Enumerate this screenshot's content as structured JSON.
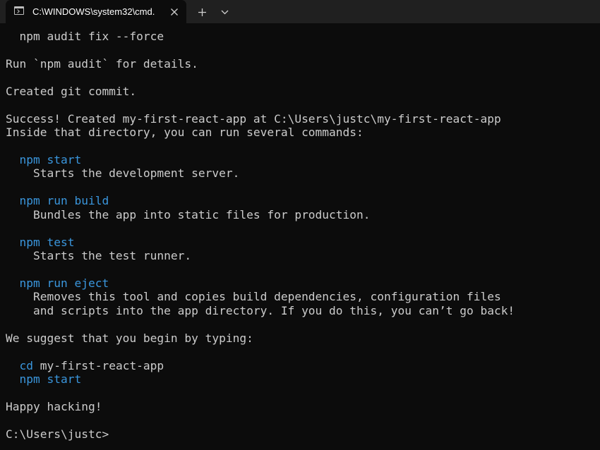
{
  "tab": {
    "title": "C:\\WINDOWS\\system32\\cmd.",
    "icon": "terminal-icon",
    "close_icon": "close-icon"
  },
  "toolbar": {
    "new_tab_icon": "plus-icon",
    "dropdown_icon": "chevron-down-icon"
  },
  "colors": {
    "background": "#0c0c0c",
    "text": "#cccccc",
    "command": "#3a96dd",
    "tabbar": "#202020"
  },
  "terminal": {
    "lines": [
      [
        {
          "t": "  npm audit fix --force"
        }
      ],
      [],
      [
        {
          "t": "Run `npm audit` for details."
        }
      ],
      [],
      [
        {
          "t": "Created git commit."
        }
      ],
      [],
      [
        {
          "t": "Success! Created my-first-react-app at C:\\Users\\justc\\my-first-react-app"
        }
      ],
      [
        {
          "t": "Inside that directory, you can run several commands:"
        }
      ],
      [],
      [
        {
          "t": "  "
        },
        {
          "t": "npm start",
          "cmd": true
        }
      ],
      [
        {
          "t": "    Starts the development server."
        }
      ],
      [],
      [
        {
          "t": "  "
        },
        {
          "t": "npm run build",
          "cmd": true
        }
      ],
      [
        {
          "t": "    Bundles the app into static files for production."
        }
      ],
      [],
      [
        {
          "t": "  "
        },
        {
          "t": "npm test",
          "cmd": true
        }
      ],
      [
        {
          "t": "    Starts the test runner."
        }
      ],
      [],
      [
        {
          "t": "  "
        },
        {
          "t": "npm run eject",
          "cmd": true
        }
      ],
      [
        {
          "t": "    Removes this tool and copies build dependencies, configuration files"
        }
      ],
      [
        {
          "t": "    and scripts into the app directory. If you do this, you can’t go back!"
        }
      ],
      [],
      [
        {
          "t": "We suggest that you begin by typing:"
        }
      ],
      [],
      [
        {
          "t": "  "
        },
        {
          "t": "cd",
          "cmd": true
        },
        {
          "t": " my-first-react-app"
        }
      ],
      [
        {
          "t": "  "
        },
        {
          "t": "npm start",
          "cmd": true
        }
      ],
      [],
      [
        {
          "t": "Happy hacking!"
        }
      ],
      [],
      [
        {
          "t": "C:\\Users\\justc>"
        }
      ]
    ]
  }
}
